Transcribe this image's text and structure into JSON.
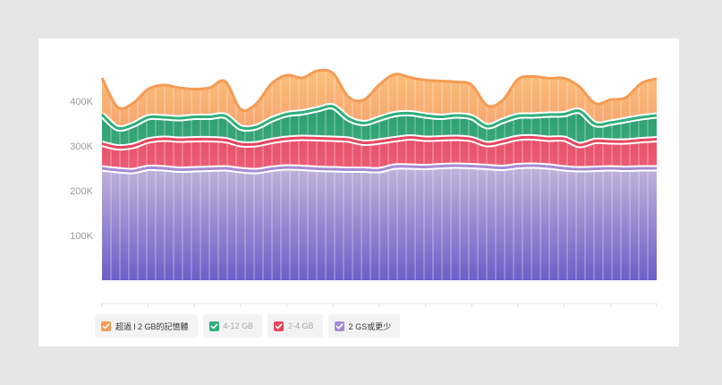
{
  "chart_data": {
    "type": "area",
    "stacked": true,
    "ylim": [
      0,
      500000
    ],
    "y_ticks": [
      {
        "value": 100000,
        "label": "100K"
      },
      {
        "value": 200000,
        "label": "200K"
      },
      {
        "value": 300000,
        "label": "300K"
      },
      {
        "value": 400000,
        "label": "400K"
      }
    ],
    "grid": true,
    "legend_position": "bottom-left",
    "series": [
      {
        "name": "2 GS或更少",
        "color": "#a78bd6",
        "gradient": [
          "#c2b4da",
          "#6d5ec8"
        ],
        "legend_active": true,
        "values": [
          250000,
          246000,
          244000,
          251000,
          250000,
          247000,
          248000,
          249000,
          250000,
          246000,
          244000,
          249000,
          252000,
          251000,
          249000,
          248000,
          247000,
          247000,
          246000,
          254000,
          254000,
          253000,
          255000,
          256000,
          255000,
          253000,
          251000,
          255000,
          256000,
          254000,
          250000,
          248000,
          249000,
          250000,
          249000,
          250000,
          250000
        ]
      },
      {
        "name": "2-4 GB",
        "color": "#e8455f",
        "gradient": [
          "#e9506a",
          "#ec8d9b"
        ],
        "legend_active": false,
        "values": [
          55000,
          51000,
          56000,
          61000,
          66000,
          67000,
          67000,
          66000,
          63000,
          58000,
          60000,
          62000,
          64000,
          67000,
          68000,
          68000,
          67000,
          60000,
          64000,
          61000,
          65000,
          63000,
          62000,
          62000,
          60000,
          51000,
          59000,
          63000,
          63000,
          62000,
          66000,
          54000,
          62000,
          60000,
          61000,
          63000,
          65000
        ]
      },
      {
        "name": "4-12 GB",
        "color": "#2eb07a",
        "gradient": [
          "#2a9f6e",
          "#6fc49e"
        ],
        "legend_active": false,
        "values": [
          65000,
          43000,
          47000,
          52000,
          48000,
          48000,
          50000,
          50000,
          54000,
          37000,
          38000,
          48000,
          55000,
          57000,
          65000,
          72000,
          47000,
          44000,
          51000,
          56000,
          54000,
          52000,
          48000,
          50000,
          49000,
          40000,
          46000,
          49000,
          49000,
          54000,
          55000,
          76000,
          38000,
          42000,
          48000,
          51000,
          53000
        ]
      },
      {
        "name": "超過 l 2 GB的記憶體",
        "color": "#f59a54",
        "gradient": [
          "#fcbf78",
          "#e4615b"
        ],
        "legend_active": true,
        "values": [
          82000,
          47000,
          48000,
          63000,
          72000,
          68000,
          62000,
          65000,
          77000,
          41000,
          52000,
          80000,
          87000,
          77000,
          86000,
          74000,
          48000,
          52000,
          76000,
          89000,
          80000,
          79000,
          80000,
          75000,
          72000,
          46000,
          46000,
          82000,
          87000,
          81000,
          80000,
          54000,
          46000,
          51000,
          50000,
          76000,
          82000
        ]
      }
    ]
  }
}
